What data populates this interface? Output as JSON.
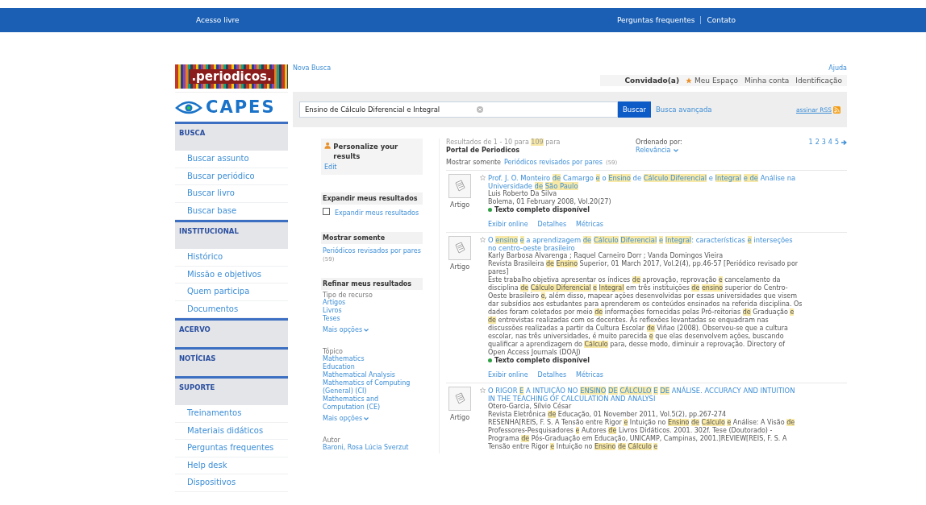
{
  "top_bar": {
    "left_link": "Acesso livre",
    "links": [
      "Perguntas frequentes",
      "Contato"
    ]
  },
  "logos": {
    "periodicos": ".periodicos.",
    "capes": "CAPES"
  },
  "sidebar": [
    {
      "heading": "BUSCA",
      "items": [
        "Buscar assunto",
        "Buscar periódico",
        "Buscar livro",
        "Buscar base"
      ]
    },
    {
      "heading": "INSTITUCIONAL",
      "items": [
        "Histórico",
        "Missão e objetivos",
        "Quem participa",
        "Documentos"
      ]
    },
    {
      "heading": "ACERVO"
    },
    {
      "heading": "NOTÍCIAS"
    },
    {
      "heading": "SUPORTE",
      "items": [
        "Treinamentos",
        "Materiais didáticos",
        "Perguntas frequentes",
        "Help desk",
        "Dispositivos"
      ]
    }
  ],
  "header": {
    "new_search": "Nova Busca",
    "help": "Ajuda",
    "user": "Convidado(a)",
    "my_space": "Meu Espaço",
    "links": [
      "Minha conta",
      "Identificação"
    ]
  },
  "search": {
    "value": "Ensino de Cálculo Diferencial e Integral",
    "button": "Buscar",
    "advanced": "Busca avançada",
    "rss": "assinar RSS"
  },
  "facets": {
    "personalize": {
      "title": "Personalize your results",
      "link": "Edit"
    },
    "expand": {
      "title": "Expandir meus resultados",
      "label": "Expandir meus resultados",
      "checked": false
    },
    "show_only": {
      "title": "Mostrar somente",
      "link": "Periódicos revisados por pares",
      "count": "(59)"
    },
    "refine": {
      "title": "Refinar meus resultados",
      "groups": [
        {
          "title": "Tipo de recurso",
          "items": [
            "Artigos",
            "Livros",
            "Teses"
          ],
          "more": "Mais opções"
        },
        {
          "title": "Tópico",
          "items": [
            "Mathematics",
            "Education",
            "Mathematical Analysis",
            "Mathematics of Computing (General) (CI)",
            "Mathematics and Computation (CE)"
          ],
          "more": "Mais opções"
        },
        {
          "title": "Autor",
          "items": [
            "Baroni, Rosa Lúcia Sverzut"
          ]
        }
      ]
    }
  },
  "results_header": {
    "summary": "Resultados de 1 - 10 para **109** para",
    "source": "Portal de Periodicos",
    "sort_label": "Ordenado por:",
    "sort_value": "Relevância",
    "pages": [
      "1",
      "2",
      "3",
      "4",
      "5"
    ],
    "filter_label": "Mostrar somente",
    "filter_link": "Periódicos revisados por pares",
    "filter_count": "(59)"
  },
  "results": [
    {
      "type": "Artigo",
      "title": "Prof. J. O. Monteiro **de** Camargo **e** o **Ensino** de **Cálculo Diferencial** e **Integral** **e de** Análise na Universidade **de** **São Paulo**",
      "authors": "Luis Roberto Da Silva",
      "source": "Bolema, 01 February 2008, Vol.20(27)",
      "availability": "Texto completo disponível",
      "actions": [
        "Exibir online",
        "Detalhes",
        "Métricas"
      ]
    },
    {
      "type": "Artigo",
      "title": "O **ensino** **e** a aprendizagem **de** **Cálculo** **Diferencial** **e** **Integral**: características **e** interseções no centro-oeste brasileiro",
      "authors": "Karly Barbosa Alvarenga ; Raquel Carneiro Dorr ; Vanda Domingos Vieira",
      "source": "Revista Brasileira **de** **Ensino** Superior, 01 March 2017, Vol.2(4), pp.46-57 [Periódico revisado por pares]",
      "abstract": "Este trabalho objetiva apresentar os índices **de** aprovação, reprovação **e** cancelamento da disciplina **de** **Cálculo Diferencial** **e** **Integral** em três instituições **de** **ensino** superior do Centro-Oeste brasileiro **e**, além disso, mapear ações desenvolvidas por essas universidades que visem dar subsídios aos estudantes para aprenderem os conteúdos ensinados na referida disciplina. Os dados foram coletados por meio **de** informações fornecidas pelas Pró-reitorias **de** Graduação **e de** entrevistas realizadas com os docentes. As reflexões levantadas se enquadram nas discussões realizadas a partir da Cultura Escolar **de** Viñao (2008). Observou-se que a cultura escolar, nas três universidades, é muito parecida **e** que elas desenvolvem ações, buscando qualificar a aprendizagem do **Cálculo** para, desse modo, diminuir a reprovação. Directory of Open Access Journals (DOAJ)",
      "availability": "Texto completo disponível",
      "actions": [
        "Exibir online",
        "Detalhes",
        "Métricas"
      ]
    },
    {
      "type": "Artigo",
      "title": "O RIGOR **E** A INTUIÇÃO NO **ENSINO** **DE** **CÁLCULO** **E** **DE** ANÁLISE. ACCURACY AND INTUITION IN THE TEACHING OF CALCULATION AND ANALYSI",
      "authors": "Otero-Garcia, Sílvio César",
      "source": "Revista Eletrônica **de** Educação, 01 November 2011, Vol.5(2), pp.267-274",
      "abstract": "RESENHA[REIS, F. S. A Tensão entre Rigor **e** Intuição no **Ensino** **de** **Cálculo** **e** Análise: A Visão **de** Professores-Pesquisadores **e** Autores **de** Livros Didáticos. 2001. 302f. Tese (Doutorado) - Programa **de** Pós-Graduação em Educação, UNICAMP, Campinas, 2001.]REVIEW[REIS, F. S. A Tensão entre Rigor **e** Intuição no **Ensino** **de** **Cálculo** **e**"
    }
  ]
}
